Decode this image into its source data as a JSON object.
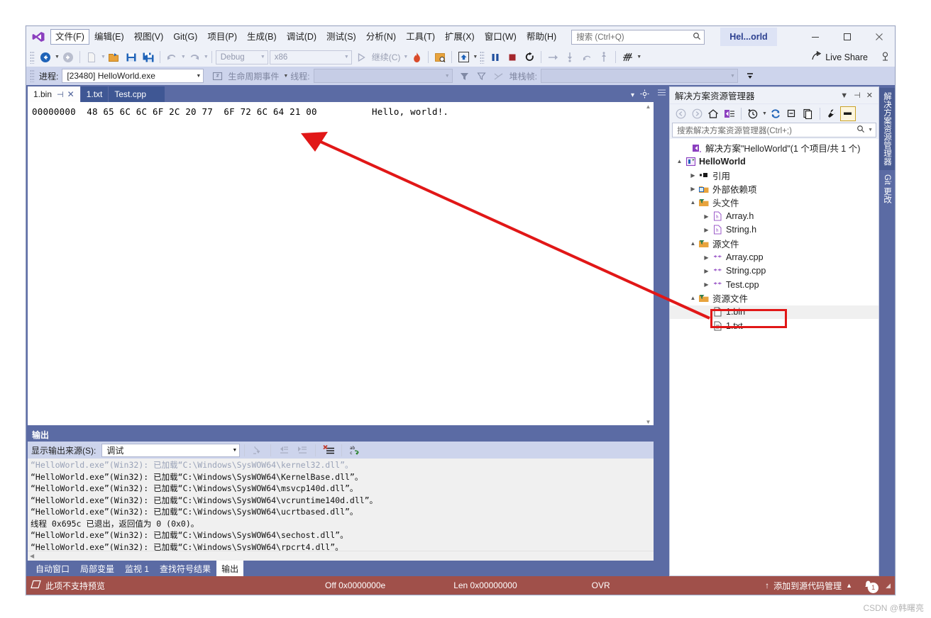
{
  "window": {
    "project_chip": "Hel...orld",
    "minimize": "─",
    "maximize": "☐",
    "close": "✕"
  },
  "menubar": {
    "items": [
      {
        "label": "文件(F)",
        "active": true
      },
      {
        "label": "编辑(E)",
        "active": false
      },
      {
        "label": "视图(V)",
        "active": false
      },
      {
        "label": "Git(G)",
        "active": false
      },
      {
        "label": "项目(P)",
        "active": false
      },
      {
        "label": "生成(B)",
        "active": false
      },
      {
        "label": "调试(D)",
        "active": false
      },
      {
        "label": "测试(S)",
        "active": false
      },
      {
        "label": "分析(N)",
        "active": false
      },
      {
        "label": "工具(T)",
        "active": false
      },
      {
        "label": "扩展(X)",
        "active": false
      },
      {
        "label": "窗口(W)",
        "active": false
      },
      {
        "label": "帮助(H)",
        "active": false
      }
    ],
    "search_placeholder": "搜索 (Ctrl+Q)"
  },
  "toolbar": {
    "config": "Debug",
    "platform": "x86",
    "continue_label": "继续(C)",
    "live_share": "Live Share"
  },
  "debugbar": {
    "process_label": "进程:",
    "process_value": "[23480] HelloWorld.exe",
    "lifecycle_label": "生命周期事件",
    "thread_label": "线程:",
    "thread_value": "",
    "stackframe_label": "堆栈帧:",
    "stackframe_value": ""
  },
  "editor": {
    "tabs": [
      {
        "label": "1.bin",
        "active": true
      },
      {
        "label": "1.txt",
        "active": false
      },
      {
        "label": "Test.cpp",
        "active": false
      }
    ],
    "hex_line": "00000000  48 65 6C 6C 6F 2C 20 77  6F 72 6C 64 21 00          Hello, world!."
  },
  "output": {
    "title": "输出",
    "source_label": "显示输出来源(S):",
    "source_value": "调试",
    "lines": [
      "“HelloWorld.exe”(Win32): 已加载“C:\\Windows\\SysWOW64\\kernel32.dll”。",
      "“HelloWorld.exe”(Win32): 已加载“C:\\Windows\\SysWOW64\\KernelBase.dll”。",
      "“HelloWorld.exe”(Win32): 已加载“C:\\Windows\\SysWOW64\\msvcp140d.dll”。",
      "“HelloWorld.exe”(Win32): 已加载“C:\\Windows\\SysWOW64\\vcruntime140d.dll”。",
      "“HelloWorld.exe”(Win32): 已加载“C:\\Windows\\SysWOW64\\ucrtbased.dll”。",
      "线程 0x695c 已退出，返回值为 0 (0x0)。",
      "“HelloWorld.exe”(Win32): 已加载“C:\\Windows\\SysWOW64\\sechost.dll”。",
      "“HelloWorld.exe”(Win32): 已加载“C:\\Windows\\SysWOW64\\rpcrt4.dll”。"
    ]
  },
  "bottom_tabs": [
    {
      "label": "自动窗口",
      "active": false
    },
    {
      "label": "局部变量",
      "active": false
    },
    {
      "label": "监视 1",
      "active": false
    },
    {
      "label": "查找符号结果",
      "active": false
    },
    {
      "label": "输出",
      "active": true
    }
  ],
  "solution_explorer": {
    "title": "解决方案资源管理器",
    "search_placeholder": "搜索解决方案资源管理器(Ctrl+;)",
    "tree": [
      {
        "indent": 0,
        "expander": "",
        "icon": "solution-icon",
        "label": "解决方案\"HelloWorld\"(1 个项目/共 1 个)",
        "bold": false,
        "selected": false
      },
      {
        "indent": 1,
        "expander": "▲",
        "icon": "project-icon",
        "label": "HelloWorld",
        "bold": true,
        "selected": false
      },
      {
        "indent": 2,
        "expander": "▶",
        "icon": "reference-icon",
        "label": "引用",
        "bold": false,
        "selected": false
      },
      {
        "indent": 2,
        "expander": "▶",
        "icon": "folder-ext-icon",
        "label": "外部依赖项",
        "bold": false,
        "selected": false
      },
      {
        "indent": 2,
        "expander": "▲",
        "icon": "filter-folder-icon",
        "label": "头文件",
        "bold": false,
        "selected": false
      },
      {
        "indent": 3,
        "expander": "▶",
        "icon": "header-file-icon",
        "label": "Array.h",
        "bold": false,
        "selected": false
      },
      {
        "indent": 3,
        "expander": "▶",
        "icon": "header-file-icon",
        "label": "String.h",
        "bold": false,
        "selected": false
      },
      {
        "indent": 2,
        "expander": "▲",
        "icon": "filter-folder-icon",
        "label": "源文件",
        "bold": false,
        "selected": false
      },
      {
        "indent": 3,
        "expander": "▶",
        "icon": "cpp-file-icon",
        "label": "Array.cpp",
        "bold": false,
        "selected": false
      },
      {
        "indent": 3,
        "expander": "▶",
        "icon": "cpp-file-icon",
        "label": "String.cpp",
        "bold": false,
        "selected": false
      },
      {
        "indent": 3,
        "expander": "▶",
        "icon": "cpp-file-icon",
        "label": "Test.cpp",
        "bold": false,
        "selected": false
      },
      {
        "indent": 2,
        "expander": "▲",
        "icon": "filter-folder-icon",
        "label": "资源文件",
        "bold": false,
        "selected": false
      },
      {
        "indent": 3,
        "expander": "",
        "icon": "bin-file-icon",
        "label": "1.bin",
        "bold": false,
        "selected": true
      },
      {
        "indent": 3,
        "expander": "",
        "icon": "txt-file-icon",
        "label": "1.txt",
        "bold": false,
        "selected": false
      }
    ]
  },
  "rail_tabs": [
    {
      "label": "解决方案资源管理器",
      "active": true
    },
    {
      "label": "Git 更改",
      "active": false
    }
  ],
  "statusbar": {
    "preview_text": "此项不支持预览",
    "offset": "Off 0x0000000e",
    "length": "Len 0x00000000",
    "overwrite": "OVR",
    "source_control": "添加到源代码管理",
    "notification_count": "1"
  },
  "watermark": "CSDN @韩曙亮",
  "colors": {
    "accent_blue": "#5b6ba4",
    "status_red": "#a0504a",
    "highlight_red": "#e11717",
    "chrome_light": "#eef1f8"
  }
}
